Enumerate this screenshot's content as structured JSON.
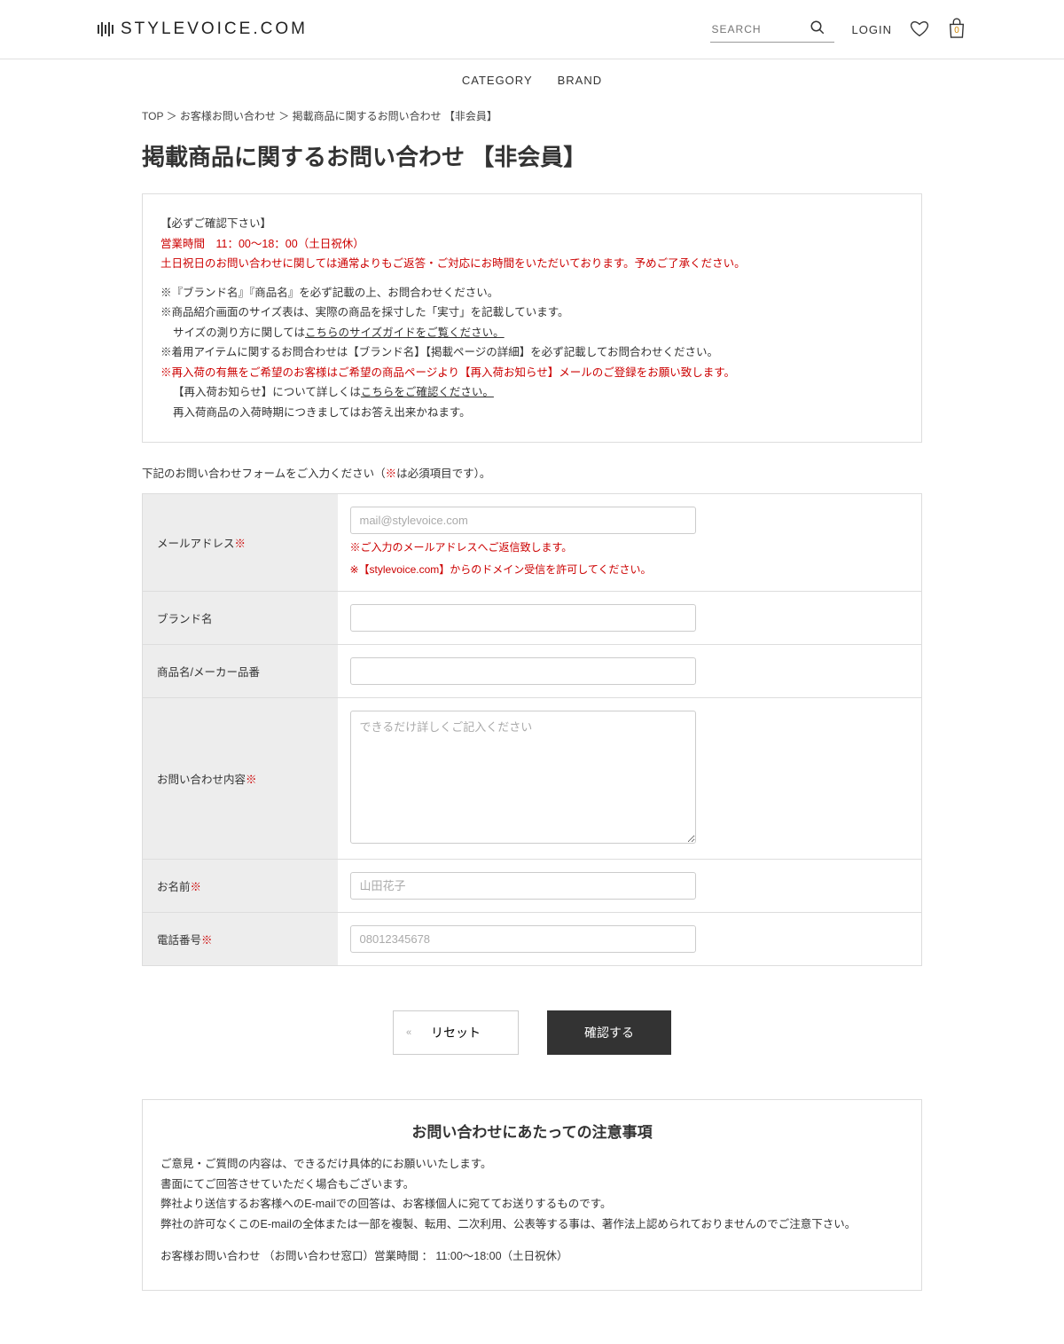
{
  "header": {
    "logo_text": "STYLEVOICE.COM",
    "search_placeholder": "SEARCH",
    "login": "LOGIN",
    "bag_count": "0"
  },
  "nav": {
    "category": "CATEGORY",
    "brand": "BRAND"
  },
  "breadcrumb": {
    "top": "TOP",
    "sep1": " ＞ ",
    "contact": "お客様お問い合わせ",
    "sep2": " ＞ ",
    "current": "掲載商品に関するお問い合わせ 【非会員】"
  },
  "page_title": "掲載商品に関するお問い合わせ 【非会員】",
  "info": {
    "confirm_title": "【必ずご確認下さい】",
    "hours": "営業時間　11：00〜18：00（土日祝休）",
    "notice_red": "土日祝日のお問い合わせに関しては通常よりもご返答・ご対応にお時間をいただいております。予めご了承ください。",
    "note1": "※『ブランド名』『商品名』を必ず記載の上、お問合わせください。",
    "note2": "※商品紹介画面のサイズ表は、実際の商品を採寸した「実寸」を記載しています。",
    "note2_b": "サイズの測り方に関しては",
    "note2_link": "こちらのサイズガイドをご覧ください。",
    "note3": "※着用アイテムに関するお問合わせは【ブランド名】【掲載ページの詳細】を必ず記載してお問合わせください。",
    "note4_red": "※再入荷の有無をご希望のお客様はご希望の商品ページより【再入荷お知らせ】メールのご登録をお願い致します。",
    "note4_b": "【再入荷お知らせ】について詳しくは",
    "note4_link": "こちらをご確認ください。",
    "note4_c": "再入荷商品の入荷時期につきましてはお答え出来かねます。"
  },
  "form_intro_a": "下記のお問い合わせフォームをご入力ください（",
  "form_intro_mark": "※",
  "form_intro_b": "は必須項目です）。",
  "form": {
    "email_label": "メールアドレス",
    "email_placeholder": "mail@stylevoice.com",
    "email_note1": "※ご入力のメールアドレスへご返信致します。",
    "email_note2": "※【stylevoice.com】からのドメイン受信を許可してください。",
    "brand_label": "ブランド名",
    "product_label": "商品名/メーカー品番",
    "content_label": "お問い合わせ内容",
    "content_placeholder": "できるだけ詳しくご記入ください",
    "name_label": "お名前",
    "name_placeholder": "山田花子",
    "phone_label": "電話番号",
    "phone_placeholder": "08012345678",
    "required_mark": "※"
  },
  "buttons": {
    "reset": "リセット",
    "submit": "確認する"
  },
  "notice": {
    "title": "お問い合わせにあたっての注意事項",
    "l1": "ご意見・ご質問の内容は、できるだけ具体的にお願いいたします。",
    "l2": "書面にてご回答させていただく場合もございます。",
    "l3": "弊社より送信するお客様へのE-mailでの回答は、お客様個人に宛ててお送りするものです。",
    "l4": "弊社の許可なくこのE-mailの全体または一部を複製、転用、二次利用、公表等する事は、著作法上認められておりませんのでご注意下さい。",
    "l5": "お客様お問い合わせ （お問い合わせ窓口）営業時間 ： 11:00〜18:00（土日祝休）"
  }
}
